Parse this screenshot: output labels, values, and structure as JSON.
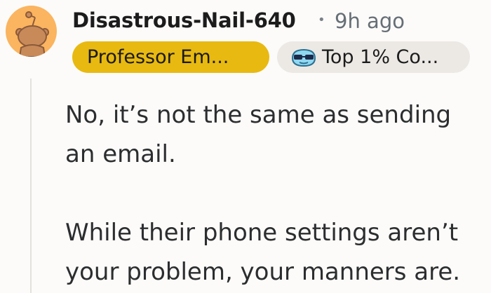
{
  "comment": {
    "author": "Disastrous-Nail-640",
    "separator": "•",
    "timestamp": "9h ago",
    "flairs": [
      {
        "label": "Professor Em...",
        "color": "#e8b911"
      },
      {
        "label": "Top 1% Co...",
        "icon": "sunglasses-emoji-icon",
        "color": "#ece9e5"
      }
    ],
    "paragraphs": [
      "No, it’s not the same as sending an email.",
      "While their phone settings aren’t your problem, your manners are."
    ]
  },
  "colors": {
    "avatar_background": "#fbb45f",
    "thread_line": "#e3e1dd",
    "page_background": "#fcfbf9"
  }
}
